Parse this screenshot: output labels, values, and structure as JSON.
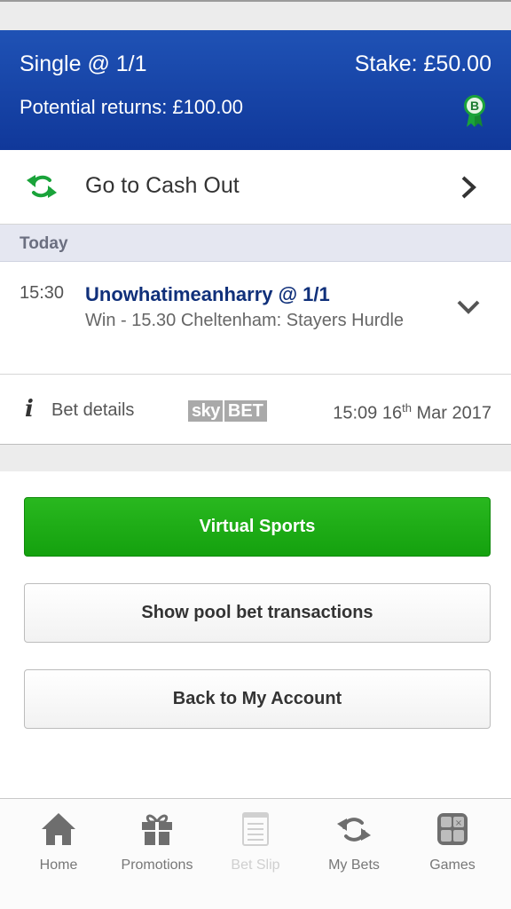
{
  "bet": {
    "type": "Single @ 1/1",
    "stake": "Stake: £50.00",
    "potential_returns": "Potential returns: £100.00",
    "badge_letter": "B"
  },
  "cashout": {
    "label": "Go to Cash Out"
  },
  "section": {
    "today": "Today"
  },
  "selection": {
    "time": "15:30",
    "name": "Unowhatimeanharry @ 1/1",
    "description": "Win - 15.30 Cheltenham: Stayers Hurdle"
  },
  "details": {
    "label": "Bet details",
    "logo_sky": "sky",
    "logo_bet": "BET",
    "time": "15:09",
    "day": "16",
    "day_suffix": "th",
    "month_year": "Mar 2017"
  },
  "buttons": {
    "virtual_sports": "Virtual Sports",
    "pool_transactions": "Show pool bet transactions",
    "back_account": "Back to My Account"
  },
  "tabs": [
    {
      "label": "Home",
      "icon": "home-icon",
      "enabled": true
    },
    {
      "label": "Promotions",
      "icon": "gift-icon",
      "enabled": true
    },
    {
      "label": "Bet Slip",
      "icon": "betslip-icon",
      "enabled": false
    },
    {
      "label": "My Bets",
      "icon": "mybets-icon",
      "enabled": true
    },
    {
      "label": "Games",
      "icon": "games-icon",
      "enabled": true
    }
  ],
  "colors": {
    "header_blue": "#1a49ab",
    "cashout_green": "#1aa33a",
    "button_green": "#1fae17",
    "selection_navy": "#10307a"
  }
}
